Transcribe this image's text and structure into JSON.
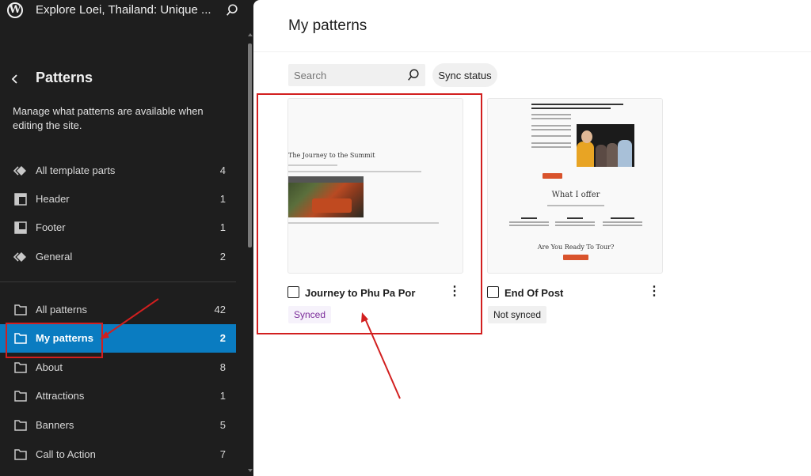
{
  "sidebar": {
    "site_title": "Explore Loei, Thailand: Unique ...",
    "logo_icon": "wordpress-logo-icon",
    "search_icon": "search-icon",
    "back_icon": "chevron-left-icon",
    "panel_title": "Patterns",
    "panel_description": "Manage what patterns are available when editing the site.",
    "template_parts": [
      {
        "label": "All template parts",
        "count": "4",
        "icon": "symbol-filled-icon"
      },
      {
        "label": "Header",
        "count": "1",
        "icon": "header-icon"
      },
      {
        "label": "Footer",
        "count": "1",
        "icon": "footer-icon"
      },
      {
        "label": "General",
        "count": "2",
        "icon": "symbol-filled-icon"
      }
    ],
    "pattern_categories": [
      {
        "label": "All patterns",
        "count": "42",
        "icon": "folder-icon",
        "active": false
      },
      {
        "label": "My patterns",
        "count": "2",
        "icon": "folder-icon",
        "active": true
      },
      {
        "label": "About",
        "count": "8",
        "icon": "folder-icon",
        "active": false
      },
      {
        "label": "Attractions",
        "count": "1",
        "icon": "folder-icon",
        "active": false
      },
      {
        "label": "Banners",
        "count": "5",
        "icon": "folder-icon",
        "active": false
      },
      {
        "label": "Call to Action",
        "count": "7",
        "icon": "folder-icon",
        "active": false
      }
    ]
  },
  "main": {
    "page_title": "My patterns",
    "search": {
      "placeholder": "Search",
      "value": ""
    },
    "sync_status_label": "Sync status",
    "patterns": [
      {
        "title": "Journey to Phu Pa Por",
        "status": "Synced",
        "preview": {
          "heading": "The Journey to the Summit"
        }
      },
      {
        "title": "End Of Post",
        "status": "Not synced",
        "preview": {
          "heading": "What I offer",
          "cta_heading": "Are You Ready To Tour?"
        }
      }
    ]
  },
  "colors": {
    "sidebar_bg": "#1e1e1e",
    "active_item": "#0a7cc1",
    "synced_text": "#7b2c9a",
    "annotation_red": "#d21f1f",
    "preview_button": "#d9532c"
  }
}
